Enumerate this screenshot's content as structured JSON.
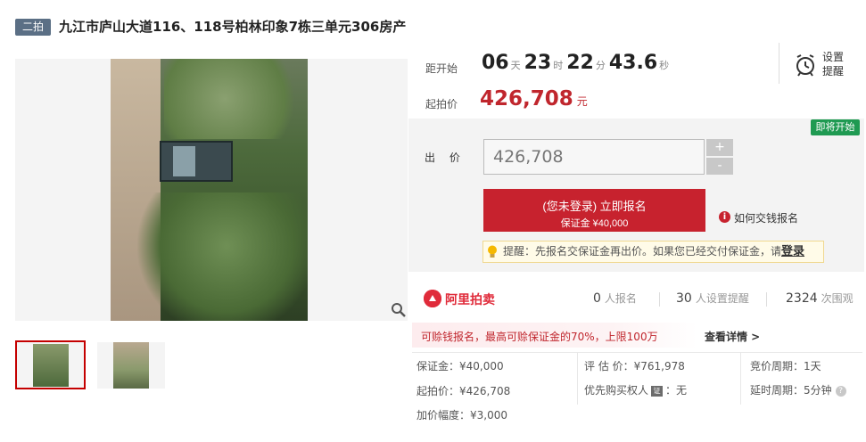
{
  "title": {
    "badge": "二拍",
    "text": "九江市庐山大道116、118号柏林印象7栋三单元306房产"
  },
  "countdown": {
    "label": "距开始",
    "days": "06",
    "days_unit": "天",
    "hours": "23",
    "hours_unit": "时",
    "minutes": "22",
    "minutes_unit": "分",
    "seconds": "43.6",
    "seconds_unit": "秒"
  },
  "reminder": {
    "line1": "设置",
    "line2": "提醒",
    "icon": "alarm-clock-icon"
  },
  "start_price": {
    "label": "起拍价",
    "value": "426,708",
    "unit": "元"
  },
  "status_badge": "即将开始",
  "bid": {
    "label": "出 价",
    "input_value": "426,708",
    "plus": "+",
    "minus": "-"
  },
  "signup": {
    "main": "(您未登录) 立即报名",
    "sub": "保证金 ¥40,000"
  },
  "how_to_pay": "如何交钱报名",
  "tip": {
    "text": "提醒：先报名交保证金再出价。如果您已经交付保证金，请",
    "login": "登录"
  },
  "platform": {
    "logo": "阿里拍卖",
    "accent": "#e02b3a"
  },
  "stats": [
    {
      "value": "0",
      "label": "人报名"
    },
    {
      "value": "30",
      "label": "人设置提醒"
    },
    {
      "value": "2324",
      "label": "次围观"
    }
  ],
  "risk": {
    "text": "可赊钱报名，最高可赊保证金的70%，上限100万",
    "link": "查看详情 >"
  },
  "details": {
    "deposit": "保证金：¥40,000",
    "start_price": "起拍价：¥426,708",
    "increment": "加价幅度：¥3,000",
    "appraisal": "评 估 价：¥761,978",
    "priority_label": "优先购买权人",
    "priority_value": "：无",
    "cycle": "竞价周期：1天",
    "delay": "延时周期：5分钟"
  },
  "colors": {
    "price_red": "#c0262d",
    "button_red": "#c7222e",
    "badge_green": "#1f9a52",
    "title_badge": "#5b6f85"
  }
}
